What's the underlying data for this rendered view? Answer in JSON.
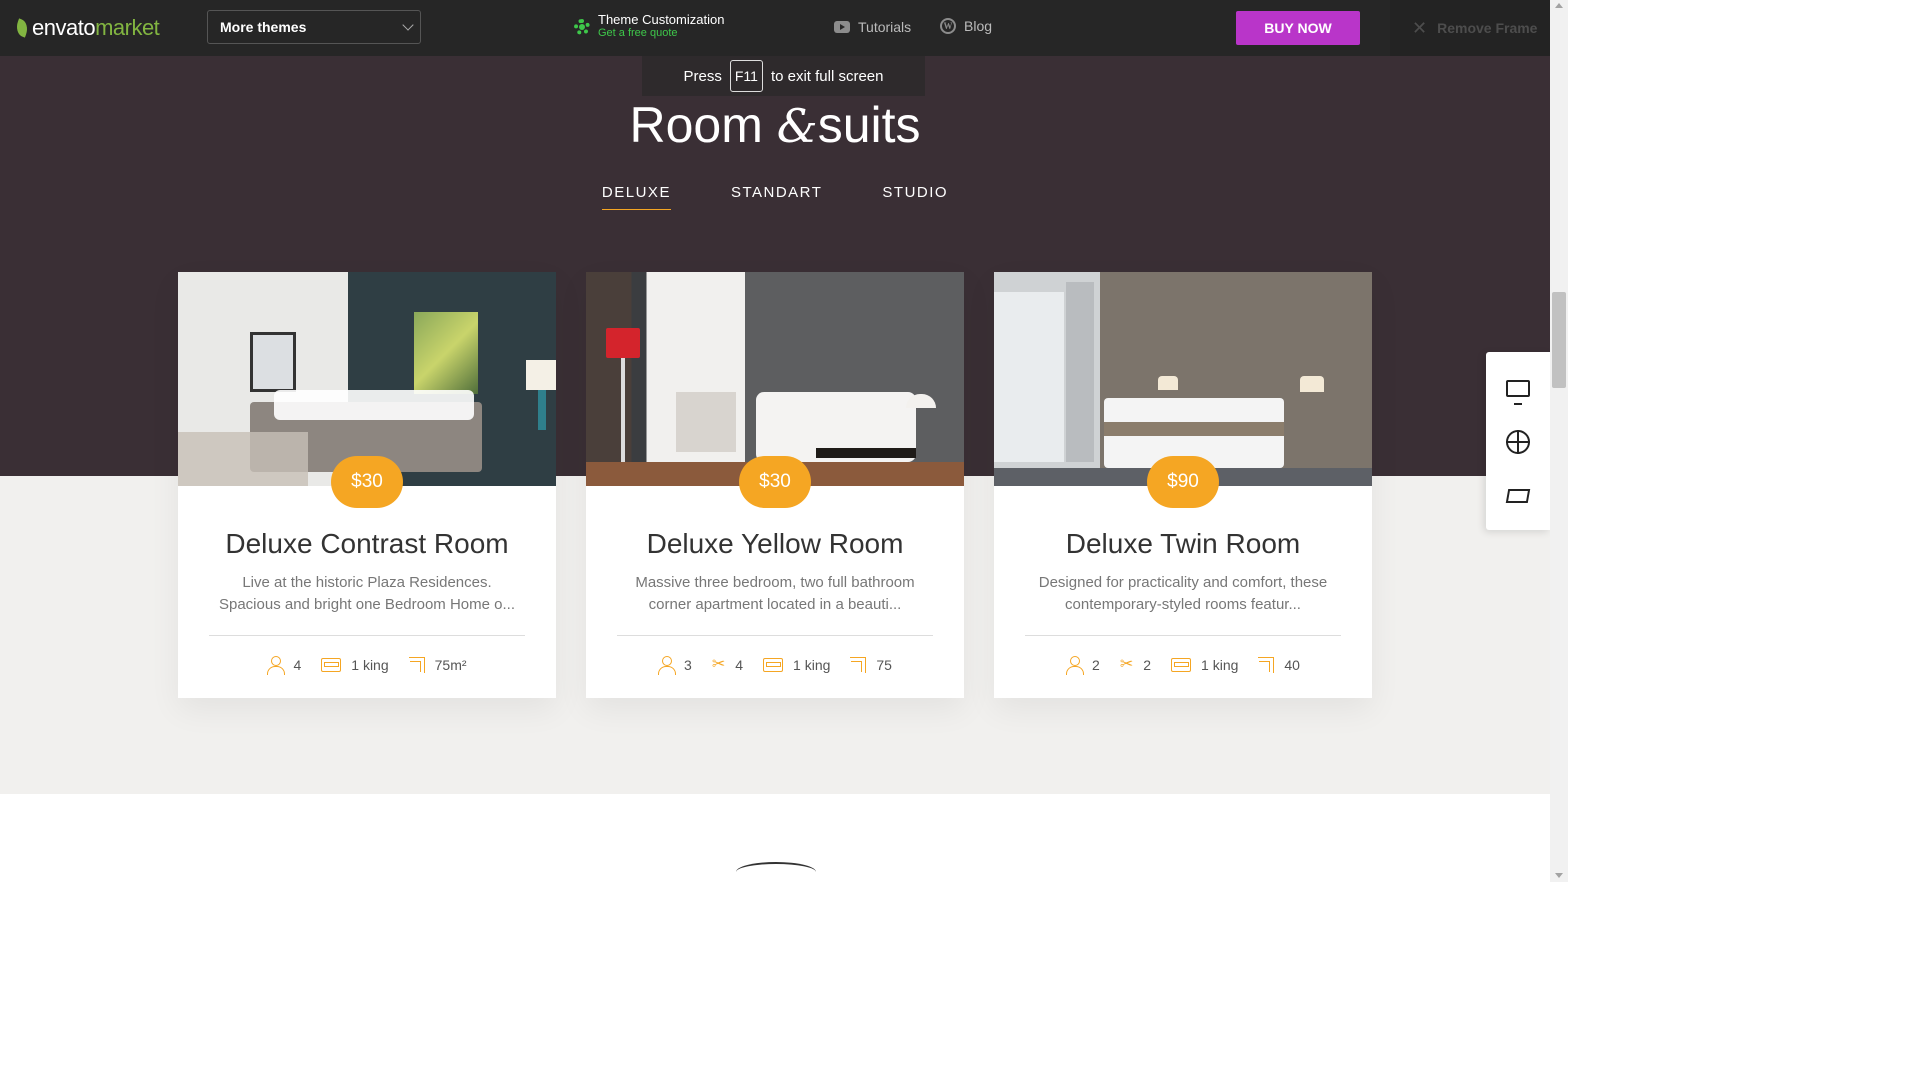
{
  "topbar": {
    "logo_a": "envato",
    "logo_b": "market",
    "themes_select": "More themes",
    "customize_title": "Theme Customization",
    "customize_sub": "Get a free quote",
    "tutorials": "Tutorials",
    "blog": "Blog",
    "buy_now": "BUY NOW",
    "remove_frame": "Remove Frame"
  },
  "fullscreen_hint": {
    "press": "Press",
    "key": "F11",
    "rest": "to exit full screen"
  },
  "section": {
    "title_a": "Room ",
    "title_amp": "&",
    "title_b": "suits",
    "tabs": [
      {
        "label": "DELUXE",
        "active": true
      },
      {
        "label": "STANDART",
        "active": false
      },
      {
        "label": "STUDIO",
        "active": false
      }
    ]
  },
  "rooms": [
    {
      "price": "$30",
      "name": "Deluxe Contrast Room",
      "desc_line1": "Live at the historic Plaza Residences.",
      "desc_line2": "Spacious and bright one Bedroom Home o...",
      "guests": "4",
      "bed": "1 king",
      "area": "75m²"
    },
    {
      "price": "$30",
      "name": "Deluxe Yellow Room",
      "desc_line1": "Massive three bedroom, two full bathroom",
      "desc_line2": "corner apartment located in a beauti...",
      "guests": "3",
      "baths": "4",
      "bed": "1 king",
      "area": "75"
    },
    {
      "price": "$90",
      "name": "Deluxe Twin Room",
      "desc_line1": "Designed for practicality and comfort, these",
      "desc_line2": "contemporary-styled rooms featur...",
      "guests": "2",
      "baths": "2",
      "bed": "1 king",
      "area": "40"
    }
  ],
  "icons": {
    "side_panel": [
      "monitor-icon",
      "lifebuoy-icon",
      "cart-icon"
    ],
    "amenities": [
      "person-icon",
      "bath-icon",
      "bed-icon",
      "area-icon"
    ]
  },
  "colors": {
    "accent": "#f5a623",
    "buy_button": "#b935c9",
    "envato_green": "#82b541",
    "dark_band": "#3a2f35"
  }
}
